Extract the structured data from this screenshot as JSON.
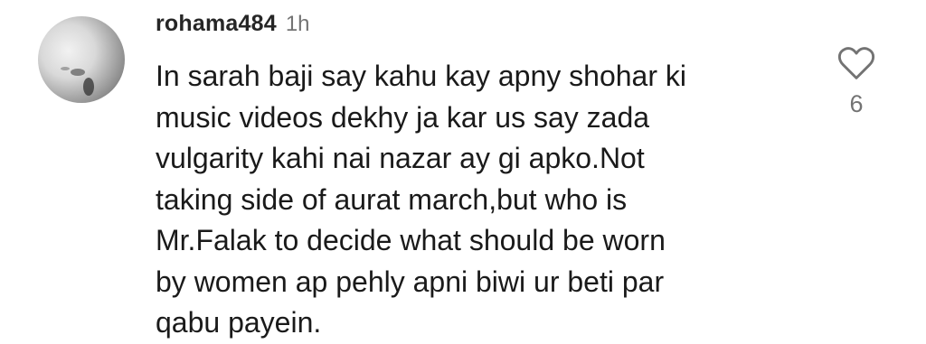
{
  "comment": {
    "username": "rohama484",
    "time": "1h",
    "text": "In sarah baji say kahu kay apny shohar ki\nmusic videos dekhy ja kar us say zada\nvulgarity kahi nai nazar ay gi apko.Not\ntaking side of aurat march,but who is\nMr.Falak to decide what should be worn\nby women ap pehly apni biwi ur beti par\nqabu payein.",
    "likes": "6",
    "like_icon": "heart-outline-icon"
  },
  "colors": {
    "username": "#262626",
    "muted": "#737373",
    "text": "#1a1a1a",
    "background": "#ffffff"
  }
}
